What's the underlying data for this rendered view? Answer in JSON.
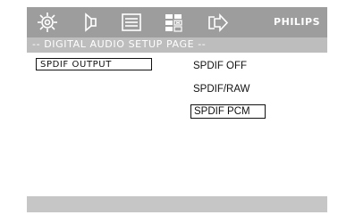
{
  "toolbar": {
    "icons": [
      "general-setup-icon",
      "speaker-setup-icon",
      "video-setup-icon",
      "preferences-icon",
      "exit-icon"
    ],
    "brand": "PHILIPS"
  },
  "title_bar": {
    "text": "-- DIGITAL AUDIO SETUP PAGE --"
  },
  "menu": {
    "selected_item": "SPDIF OUTPUT"
  },
  "options": [
    "SPDIF OFF",
    "SPDIF/RAW",
    "SPDIF PCM"
  ],
  "selected_option": "SPDIF PCM",
  "colors": {
    "toolbar": "#9d9d9d",
    "title_bar": "#bdbdbd",
    "bottom_bar": "#c6c6c6",
    "text": "#111111"
  }
}
